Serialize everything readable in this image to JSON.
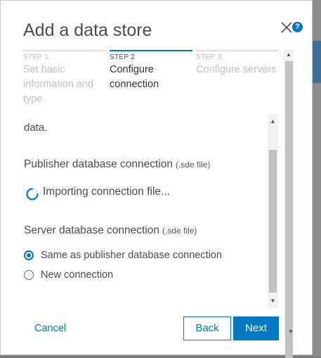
{
  "dialog": {
    "title": "Add a data store",
    "help_glyph": "?"
  },
  "steps": [
    {
      "number": "STEP 1",
      "label_lines": [
        "Set basic",
        "information and",
        "type"
      ]
    },
    {
      "number": "STEP 2",
      "label_lines": [
        "Configure",
        "connection"
      ]
    },
    {
      "number": "STEP 3",
      "label_lines": [
        "Configure servers"
      ]
    }
  ],
  "content": {
    "partial_text": "data.",
    "publisher": {
      "label": "Publisher database connection",
      "hint": "(.sde file)"
    },
    "importing_text": "Importing connection file...",
    "server": {
      "label": "Server database connection",
      "hint": "(.sde file)"
    },
    "options": [
      {
        "label": "Same as publisher database connection",
        "selected": true
      },
      {
        "label": "New connection",
        "selected": false
      }
    ]
  },
  "footer": {
    "cancel_label": "Cancel",
    "back_label": "Back",
    "next_label": "Next"
  },
  "colors": {
    "accent": "#0079c1",
    "text": "#4c4c4c",
    "disabled_text": "#c2c2c2"
  },
  "icons": {
    "close": "close-icon",
    "help": "help-icon",
    "spinner": "loading-spinner-icon",
    "scroll_up": "scroll-up-arrow",
    "scroll_down": "scroll-down-arrow"
  }
}
